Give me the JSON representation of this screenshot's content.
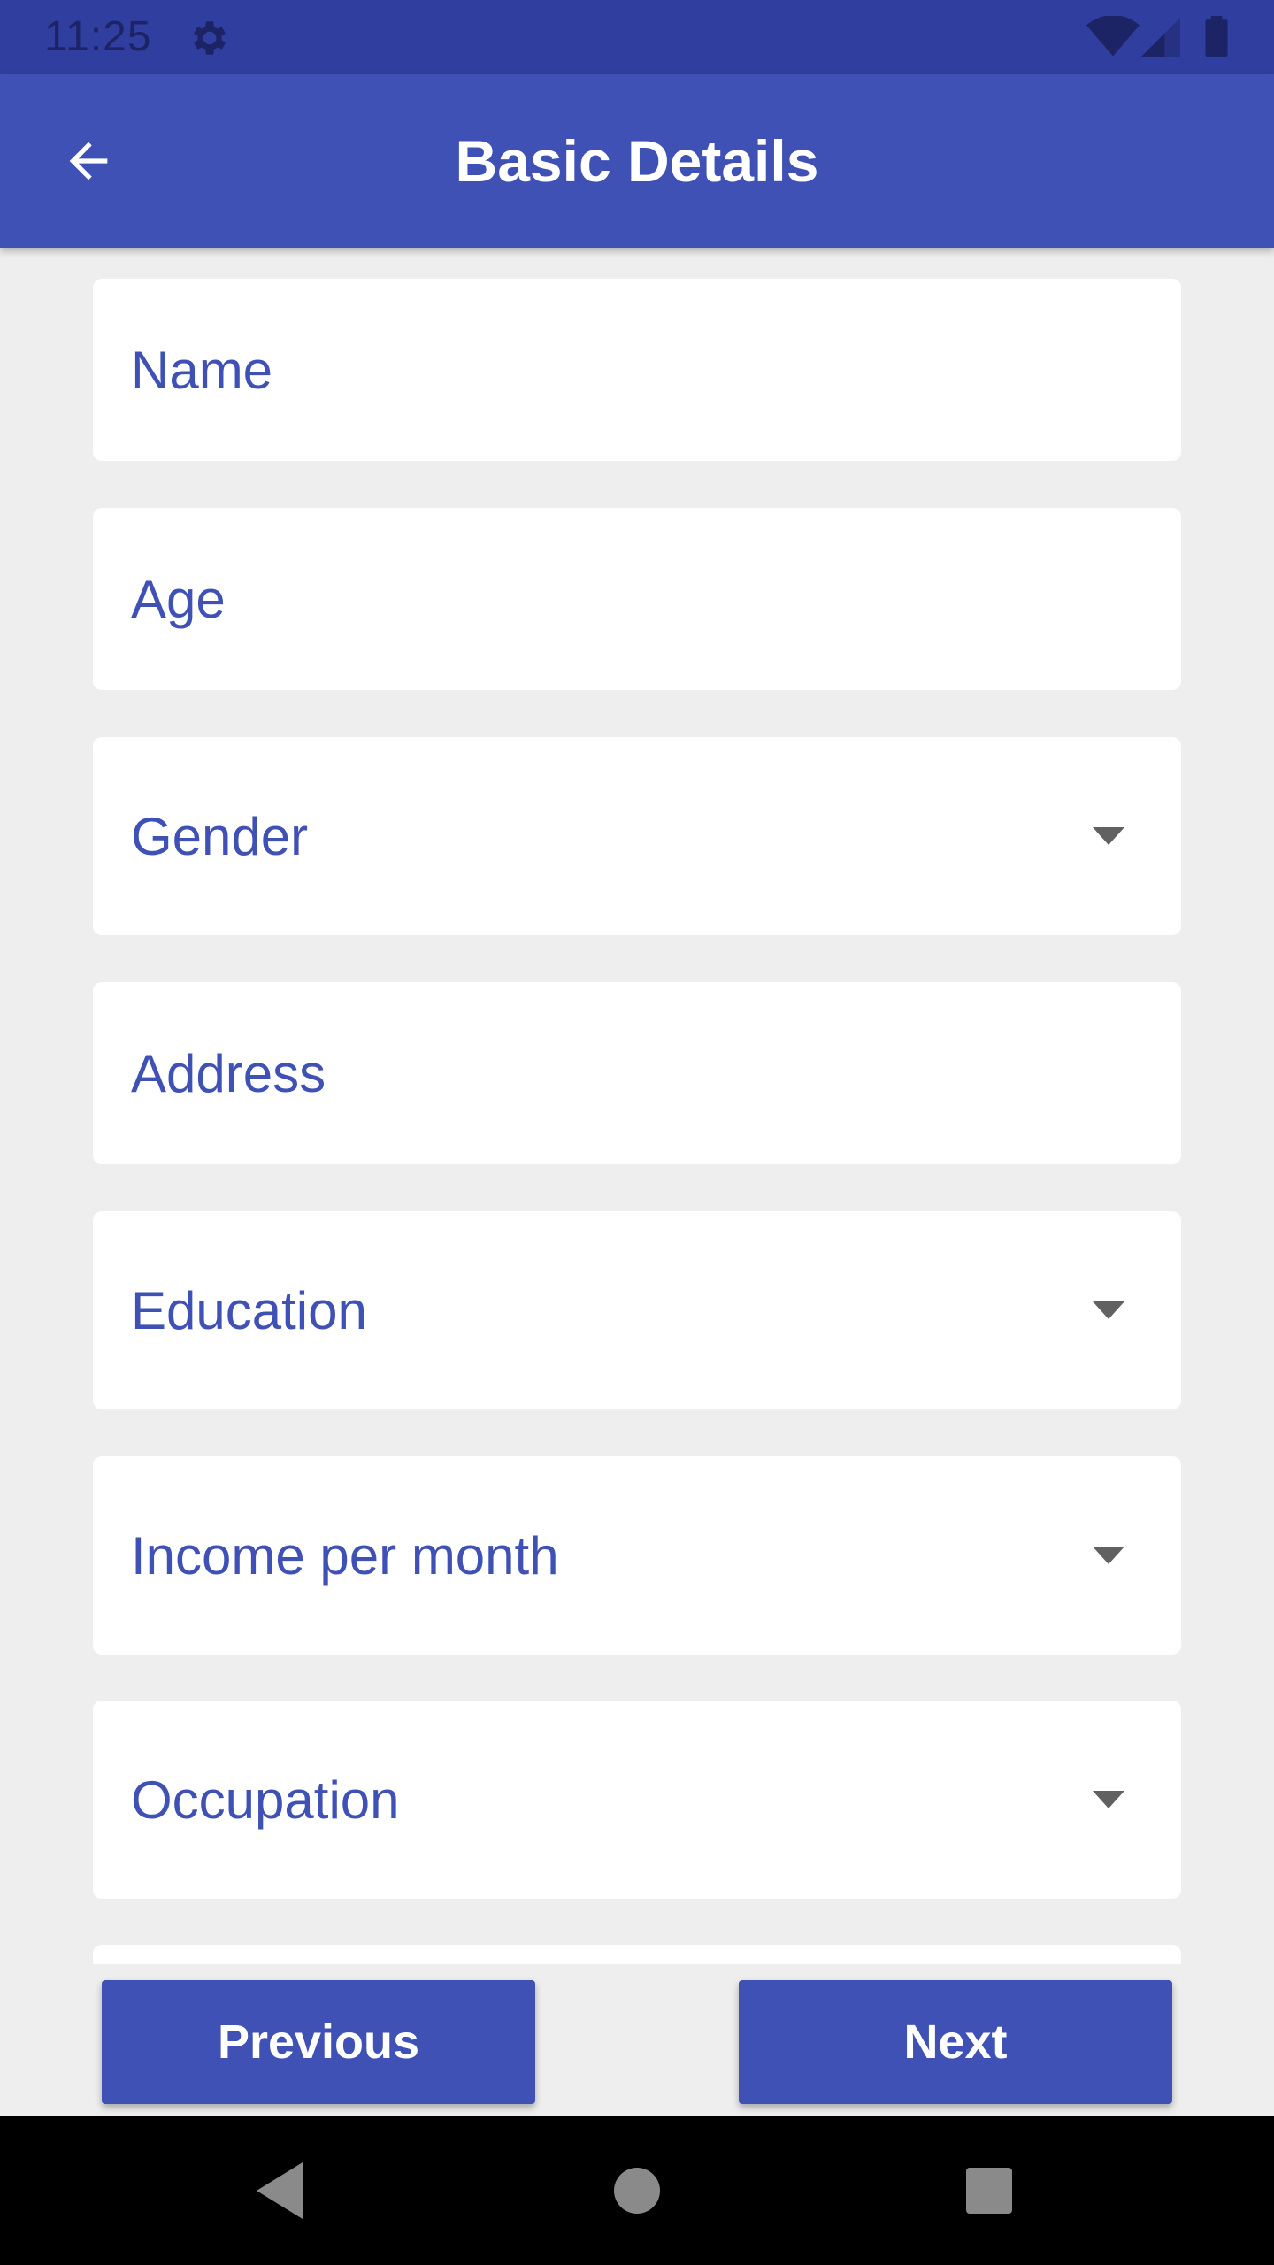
{
  "status_bar": {
    "time": "11:25"
  },
  "app_bar": {
    "title": "Basic Details"
  },
  "form": {
    "fields": [
      {
        "label": "Name",
        "type": "text"
      },
      {
        "label": "Age",
        "type": "text"
      },
      {
        "label": "Gender",
        "type": "dropdown"
      },
      {
        "label": "Address",
        "type": "text"
      },
      {
        "label": "Education",
        "type": "dropdown"
      },
      {
        "label": "Income per month",
        "type": "dropdown"
      },
      {
        "label": "Occupation",
        "type": "dropdown"
      }
    ]
  },
  "buttons": {
    "previous": "Previous",
    "next": "Next"
  },
  "icons": {
    "back": "arrow-back-icon",
    "settings": "gear-icon",
    "wifi": "wifi-icon",
    "signal": "cell-signal-icon",
    "battery": "battery-icon",
    "dropdown": "chevron-down-icon",
    "nav_back": "nav-back-icon",
    "nav_home": "nav-home-icon",
    "nav_recents": "nav-recents-icon"
  },
  "colors": {
    "primary": "#3f51b5",
    "primary_dark": "#303f9f",
    "background": "#eeeeee",
    "card": "#ffffff",
    "dropdown_arrow": "#616161"
  }
}
